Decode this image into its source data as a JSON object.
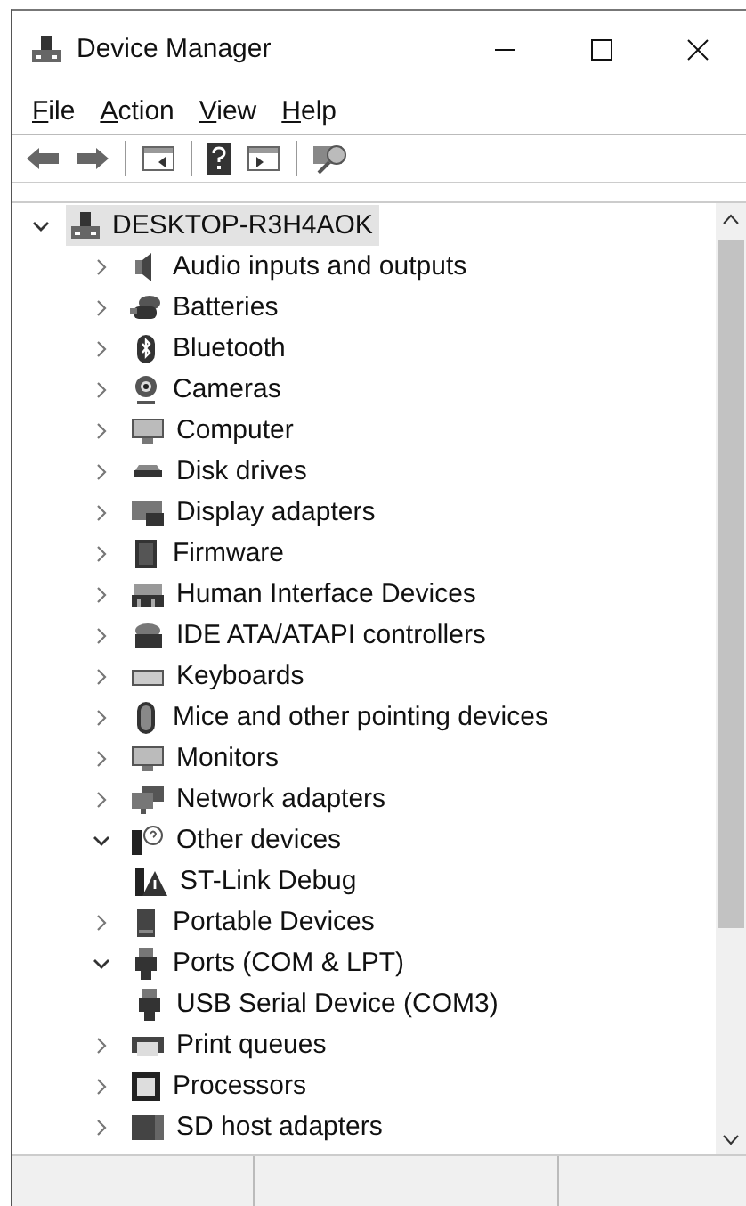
{
  "window": {
    "title": "Device Manager"
  },
  "menu": [
    "File",
    "Action",
    "View",
    "Help"
  ],
  "tree": {
    "label": "DESKTOP-R3H4AOK",
    "expanded": true,
    "selected": true,
    "children": [
      {
        "label": "Audio inputs and outputs",
        "expanded": false,
        "selected": false
      },
      {
        "label": "Batteries",
        "expanded": false,
        "selected": false
      },
      {
        "label": "Bluetooth",
        "expanded": false,
        "selected": false
      },
      {
        "label": "Cameras",
        "expanded": false,
        "selected": false
      },
      {
        "label": "Computer",
        "expanded": false,
        "selected": false
      },
      {
        "label": "Disk drives",
        "expanded": false,
        "selected": false
      },
      {
        "label": "Display adapters",
        "expanded": false,
        "selected": false
      },
      {
        "label": "Firmware",
        "expanded": false,
        "selected": false
      },
      {
        "label": "Human Interface Devices",
        "expanded": false,
        "selected": false
      },
      {
        "label": "IDE ATA/ATAPI controllers",
        "expanded": false,
        "selected": false
      },
      {
        "label": "Keyboards",
        "expanded": false,
        "selected": false
      },
      {
        "label": "Mice and other pointing devices",
        "expanded": false,
        "selected": false
      },
      {
        "label": "Monitors",
        "expanded": false,
        "selected": false
      },
      {
        "label": "Network adapters",
        "expanded": false,
        "selected": false
      },
      {
        "label": "Other devices",
        "expanded": true,
        "selected": false,
        "children": [
          {
            "label": "ST-Link Debug",
            "selected": false
          }
        ]
      },
      {
        "label": "Portable Devices",
        "expanded": false,
        "selected": false
      },
      {
        "label": "Ports (COM & LPT)",
        "expanded": true,
        "selected": false,
        "children": [
          {
            "label": "USB Serial Device (COM3)",
            "selected": false
          }
        ]
      },
      {
        "label": "Print queues",
        "expanded": false,
        "selected": false
      },
      {
        "label": "Processors",
        "expanded": false,
        "selected": false
      },
      {
        "label": "SD host adapters",
        "expanded": false,
        "selected": false
      }
    ]
  }
}
